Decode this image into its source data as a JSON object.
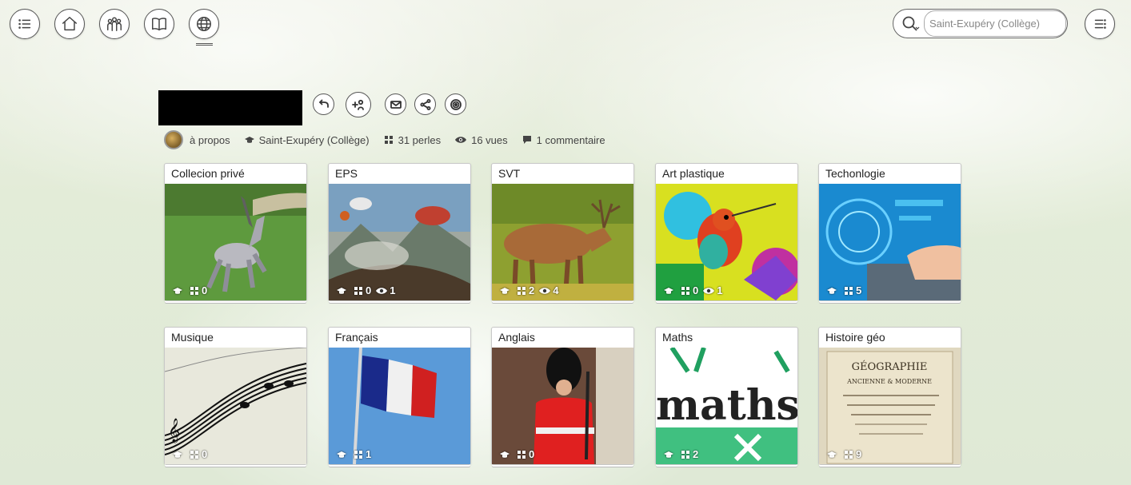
{
  "nav": {
    "items": [
      {
        "name": "menu-list-icon"
      },
      {
        "name": "home-icon"
      },
      {
        "name": "group-icon"
      },
      {
        "name": "book-icon"
      },
      {
        "name": "globe-icon"
      }
    ],
    "active": "globe-icon"
  },
  "search": {
    "placeholder": "Saint-Exupéry (Collège)",
    "icon": "search-icon"
  },
  "header": {
    "title_redacted": true,
    "actions": [
      "back-arrow-icon",
      "add-follower-icon",
      "mail-icon",
      "share-icon",
      "target-icon"
    ]
  },
  "meta": {
    "about": "à propos",
    "school": "Saint-Exupéry (Collège)",
    "pearls": "31 perles",
    "views": "16 vues",
    "comments": "1 commentaire"
  },
  "cards": [
    {
      "title": "Collecion privé",
      "school": "",
      "pearls": "0",
      "views": null
    },
    {
      "title": "EPS",
      "school": "",
      "pearls": "0",
      "views": "1"
    },
    {
      "title": "SVT",
      "school": "",
      "pearls": "2",
      "views": "4"
    },
    {
      "title": "Art plastique",
      "school": "",
      "pearls": "0",
      "views": "1"
    },
    {
      "title": "Techonlogie",
      "school": "",
      "pearls": "5",
      "views": null
    },
    {
      "title": "Musique",
      "school": "",
      "pearls": "0",
      "views": null
    },
    {
      "title": "Français",
      "school": "",
      "pearls": "1",
      "views": null
    },
    {
      "title": "Anglais",
      "school": "",
      "pearls": "0",
      "views": null
    },
    {
      "title": "Maths",
      "school": "",
      "pearls": "2",
      "views": null
    },
    {
      "title": "Histoire géo",
      "school": "",
      "pearls": "9",
      "views": null
    }
  ],
  "thumb_texts": {
    "maths": "maths",
    "geo_line1": "GÉOGRAPHIE",
    "geo_line2": "ANCIENNE & MODERNE"
  },
  "colors": {
    "accent": "#555555",
    "card_border": "#c8c8c8"
  }
}
